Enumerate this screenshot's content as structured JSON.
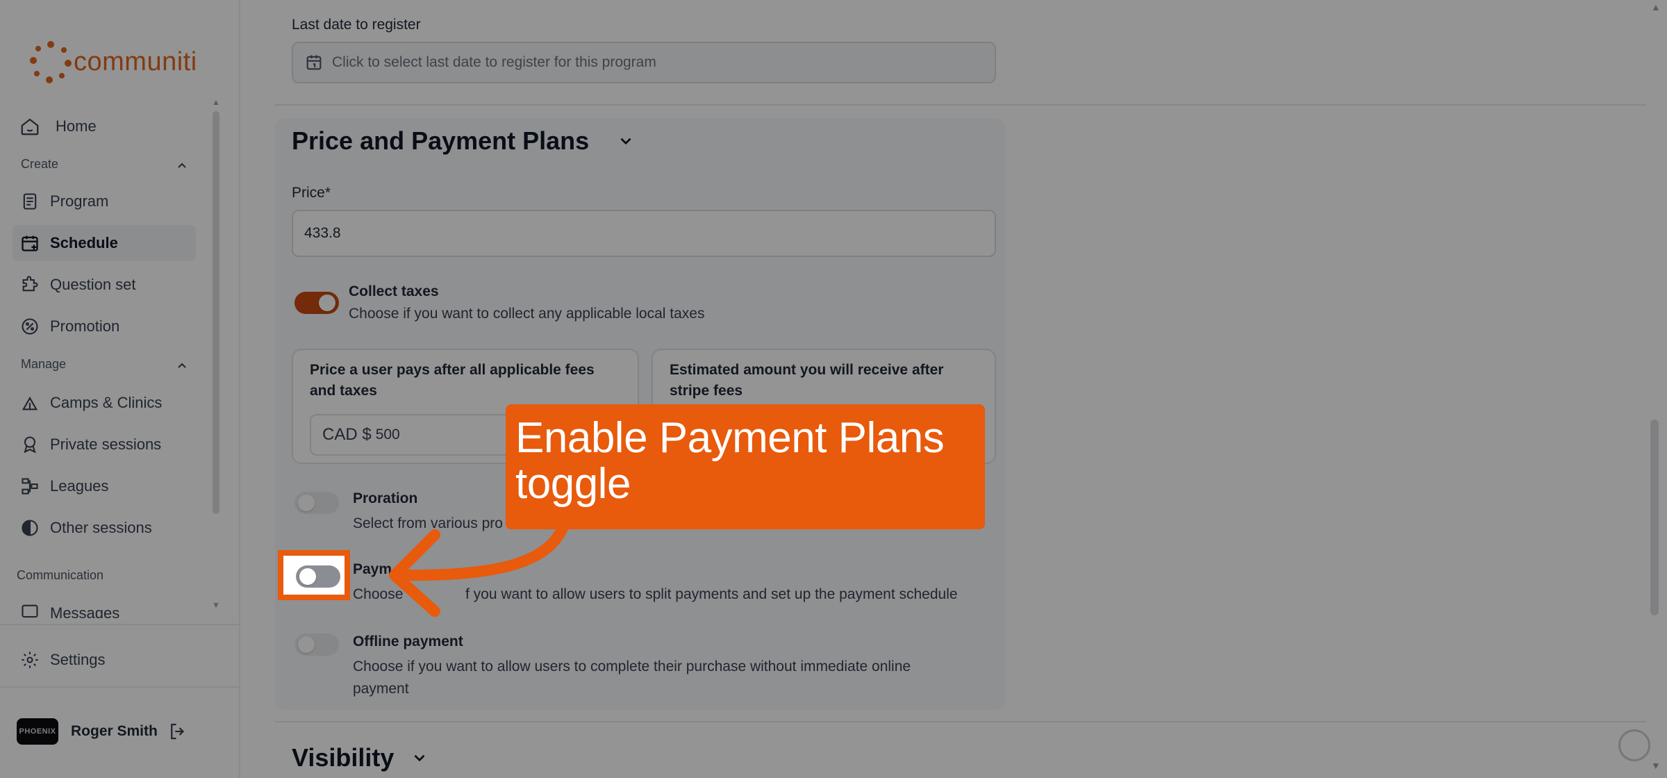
{
  "brand": {
    "name": "communiti",
    "accent": "#e85a0c"
  },
  "sidebar": {
    "home": "Home",
    "create_label": "Create",
    "create_items": [
      "Program",
      "Schedule",
      "Question set",
      "Promotion"
    ],
    "manage_label": "Manage",
    "manage_items": [
      "Camps & Clinics",
      "Private sessions",
      "Leagues",
      "Other sessions"
    ],
    "communication_label": "Communication",
    "communication_items": [
      "Messages"
    ],
    "settings": "Settings",
    "user": {
      "name": "Roger Smith",
      "avatar_text": "PHOENIX"
    }
  },
  "main": {
    "last_date": {
      "label": "Last date to register",
      "placeholder": "Click to select last date to register for this program"
    },
    "price_section": {
      "title": "Price and Payment Plans",
      "price_label": "Price*",
      "price_value": "433.8",
      "collect_taxes": {
        "title": "Collect taxes",
        "desc": "Choose if you want to collect any applicable local taxes",
        "on": true
      },
      "fee_card_1": {
        "label_1": "Price a user pays after all applicable fees",
        "label_2": "and taxes",
        "currency": "CAD $",
        "amount": "500"
      },
      "fee_card_2": {
        "label_1": "Estimated amount you will receive after",
        "label_2": "stripe fees"
      },
      "proration": {
        "title": "Proration",
        "desc": "Select from various pro"
      },
      "payment_plans": {
        "title": "Paym",
        "desc_start": "Choose",
        "desc_end": "f you want to allow users to split payments and set up the payment schedule"
      },
      "offline_payment": {
        "title": "Offline payment",
        "desc_1": "Choose if you want to allow users to complete their purchase without immediate online",
        "desc_2": "payment"
      }
    },
    "visibility_section": {
      "title": "Visibility"
    }
  },
  "callout": {
    "line_1": "Enable Payment Plans",
    "line_2": "toggle"
  }
}
